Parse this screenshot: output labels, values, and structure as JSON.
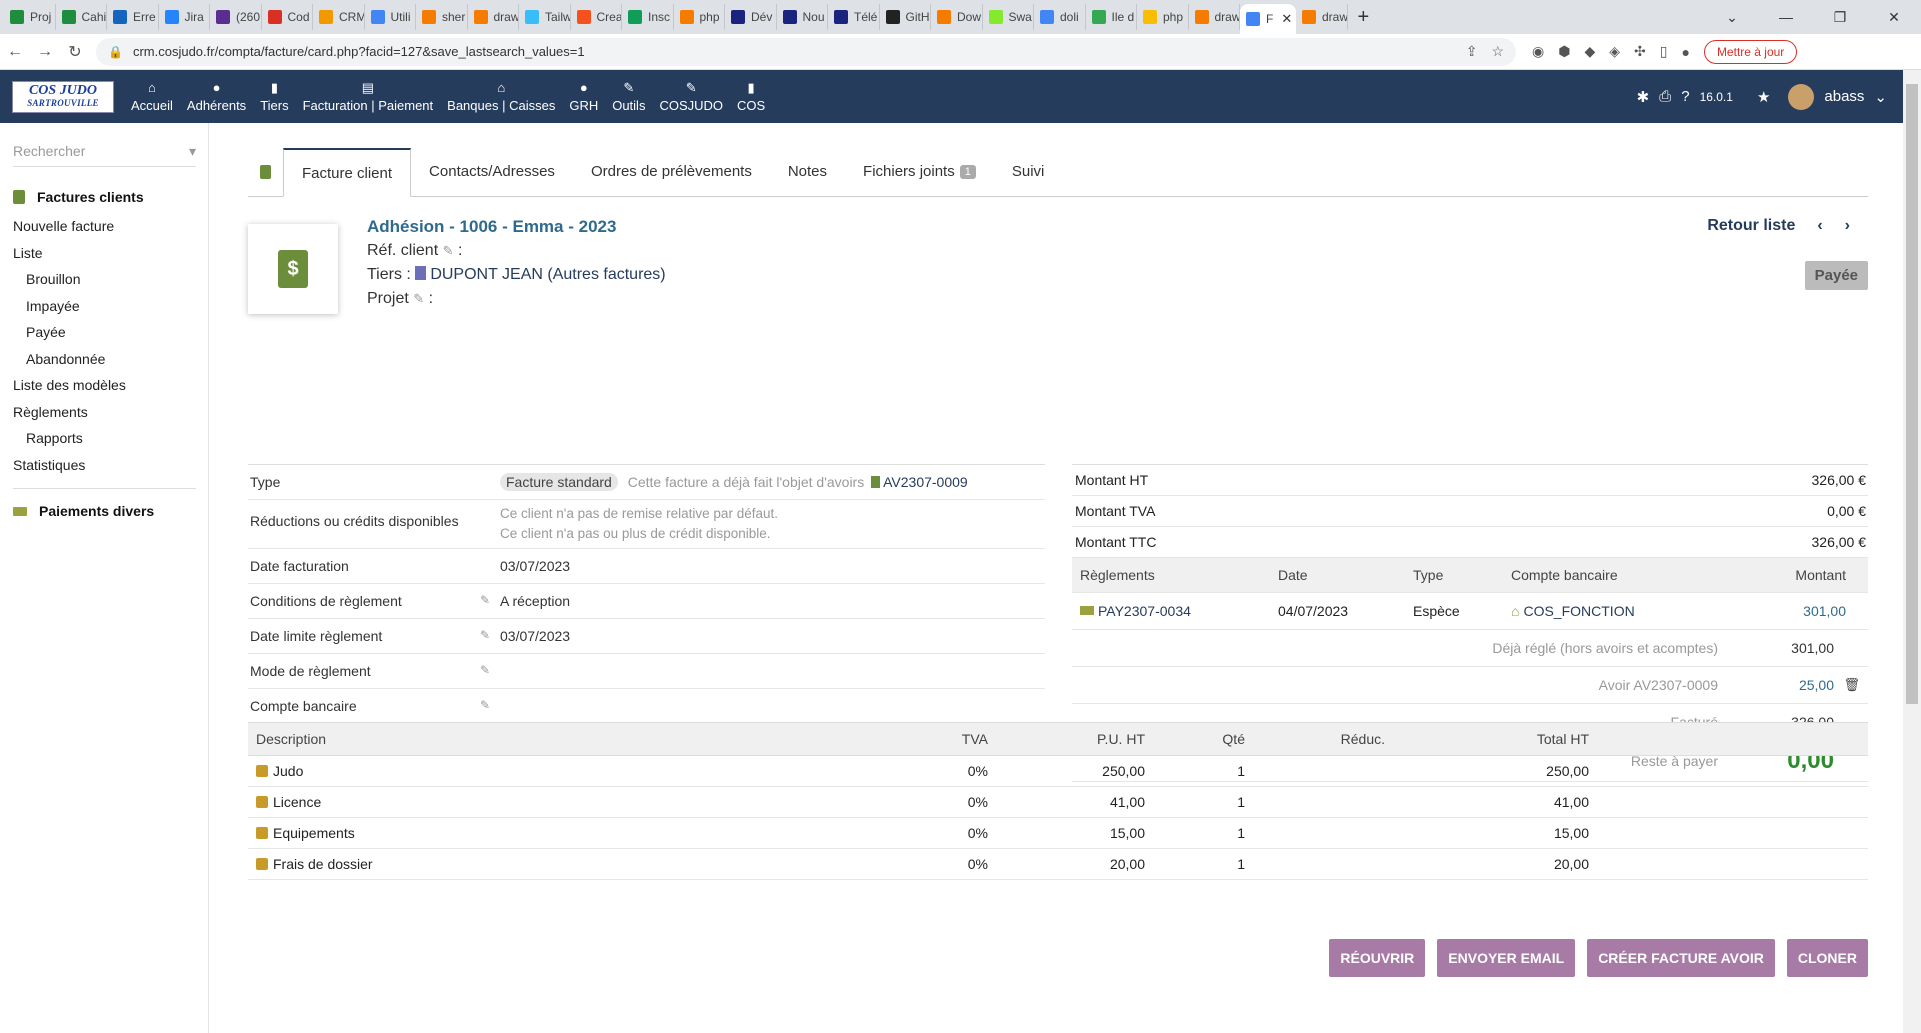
{
  "browser": {
    "tabs": [
      {
        "label": "Proj",
        "color": "#1e8e3e"
      },
      {
        "label": "Cahi",
        "color": "#1e8e3e"
      },
      {
        "label": "Erre",
        "color": "#1565c0"
      },
      {
        "label": "Jira",
        "color": "#2684ff"
      },
      {
        "label": "(260",
        "color": "#5c2d91"
      },
      {
        "label": "Cod",
        "color": "#d93025"
      },
      {
        "label": "CRM",
        "color": "#f29900"
      },
      {
        "label": "Utili",
        "color": "#4285f4"
      },
      {
        "label": "sher",
        "color": "#f57c00"
      },
      {
        "label": "draw",
        "color": "#f57c00"
      },
      {
        "label": "Tailw",
        "color": "#38bdf8"
      },
      {
        "label": "Crea",
        "color": "#f4511e"
      },
      {
        "label": "Insc",
        "color": "#0f9d58"
      },
      {
        "label": "php",
        "color": "#f57c00"
      },
      {
        "label": "Dév",
        "color": "#1a237e"
      },
      {
        "label": "Nou",
        "color": "#1a237e"
      },
      {
        "label": "Télé",
        "color": "#1a237e"
      },
      {
        "label": "GitH",
        "color": "#222222"
      },
      {
        "label": "Dow",
        "color": "#f57c00"
      },
      {
        "label": "Swa",
        "color": "#85ea2d"
      },
      {
        "label": "doli",
        "color": "#4285f4"
      },
      {
        "label": "Ile d",
        "color": "#34a853"
      },
      {
        "label": "php",
        "color": "#fbbc04"
      },
      {
        "label": "draw",
        "color": "#f57c00"
      },
      {
        "label": "F",
        "color": "#4285f4",
        "active": true
      },
      {
        "label": "draw",
        "color": "#f57c00"
      }
    ],
    "new_tab": "+",
    "window_controls": [
      "⌄",
      "—",
      "❐",
      "✕"
    ],
    "url": "crm.cosjudo.fr/compta/facture/card.php?facid=127&save_lastsearch_values=1",
    "update_button": "Mettre à jour"
  },
  "app": {
    "logo_line1": "COS JUDO",
    "logo_line2": "SARTROUVILLE",
    "menu": [
      {
        "label": "Accueil",
        "icon": "home-icon",
        "glyph": "⌂"
      },
      {
        "label": "Adhérents",
        "icon": "user-icon",
        "glyph": "●"
      },
      {
        "label": "Tiers",
        "icon": "building-icon",
        "glyph": "▮"
      },
      {
        "label": "Facturation | Paiement",
        "icon": "invoice-icon",
        "glyph": "▤"
      },
      {
        "label": "Banques | Caisses",
        "icon": "bank-icon",
        "glyph": "⌂"
      },
      {
        "label": "GRH",
        "icon": "users-icon",
        "glyph": "●"
      },
      {
        "label": "Outils",
        "icon": "wrench-icon",
        "glyph": "✎"
      },
      {
        "label": "COSJUDO",
        "icon": "edit-icon",
        "glyph": "✎"
      },
      {
        "label": "COS",
        "icon": "note-icon",
        "glyph": "▮"
      }
    ],
    "version": "16.0.1",
    "user": "abass"
  },
  "sidebar": {
    "search_placeholder": "Rechercher",
    "section1": "Factures clients",
    "items": [
      {
        "label": "Nouvelle facture",
        "sub": false
      },
      {
        "label": "Liste",
        "sub": false
      },
      {
        "label": "Brouillon",
        "sub": true
      },
      {
        "label": "Impayée",
        "sub": true
      },
      {
        "label": "Payée",
        "sub": true
      },
      {
        "label": "Abandonnée",
        "sub": true
      },
      {
        "label": "Liste des modèles",
        "sub": false
      },
      {
        "label": "Règlements",
        "sub": false
      },
      {
        "label": "Rapports",
        "sub": true
      },
      {
        "label": "Statistiques",
        "sub": false
      }
    ],
    "section2": "Paiements divers"
  },
  "tabs": [
    {
      "label": "Facture client",
      "active": true
    },
    {
      "label": "Contacts/Adresses"
    },
    {
      "label": "Ordres de prélèvements"
    },
    {
      "label": "Notes"
    },
    {
      "label": "Fichiers joints",
      "badge": "1"
    },
    {
      "label": "Suivi"
    }
  ],
  "invoice": {
    "title": "Adhésion - 1006 - Emma - 2023",
    "ref_client_label": "Réf. client",
    "tiers_label": "Tiers :",
    "tiers_value": "DUPONT JEAN (Autres factures)",
    "projet_label": "Projet",
    "back_to_list": "Retour liste",
    "status": "Payée"
  },
  "fields": {
    "type_label": "Type",
    "type_tag": "Facture standard",
    "type_note": "Cette facture a déjà fait l'objet d'avoirs",
    "type_credit_ref": "AV2307-0009",
    "discounts_label": "Réductions ou crédits disponibles",
    "discounts_line1": "Ce client n'a pas de remise relative par défaut.",
    "discounts_line2": "Ce client n'a pas ou plus de crédit disponible.",
    "date_label": "Date facturation",
    "date_value": "03/07/2023",
    "conditions_label": "Conditions de règlement",
    "conditions_value": "A réception",
    "due_label": "Date limite règlement",
    "due_value": "03/07/2023",
    "mode_label": "Mode de règlement",
    "mode_value": "",
    "bank_label": "Compte bancaire",
    "bank_value": ""
  },
  "amounts": {
    "ht_label": "Montant HT",
    "ht_value": "326,00 €",
    "tva_label": "Montant TVA",
    "tva_value": "0,00 €",
    "ttc_label": "Montant TTC",
    "ttc_value": "326,00 €"
  },
  "payments": {
    "headers": [
      "Règlements",
      "Date",
      "Type",
      "Compte bancaire",
      "Montant"
    ],
    "rows": [
      {
        "ref": "PAY2307-0034",
        "date": "04/07/2023",
        "type": "Espèce",
        "account": "COS_FONCTION",
        "amount": "301,00"
      }
    ],
    "already_paid_label": "Déjà réglé (hors avoirs et acomptes)",
    "already_paid_value": "301,00",
    "credit_label": "Avoir AV2307-0009",
    "credit_value": "25,00",
    "billed_label": "Facturé",
    "billed_value": "326,00",
    "remaining_label": "Reste à payer",
    "remaining_value": "0,00"
  },
  "lines": {
    "headers": [
      "Description",
      "TVA",
      "P.U. HT",
      "Qté",
      "Réduc.",
      "Total HT"
    ],
    "rows": [
      {
        "desc": "Judo",
        "tva": "0%",
        "pu": "250,00",
        "qty": "1",
        "reduc": "",
        "total": "250,00"
      },
      {
        "desc": "Licence",
        "tva": "0%",
        "pu": "41,00",
        "qty": "1",
        "reduc": "",
        "total": "41,00"
      },
      {
        "desc": "Equipements",
        "tva": "0%",
        "pu": "15,00",
        "qty": "1",
        "reduc": "",
        "total": "15,00"
      },
      {
        "desc": "Frais de dossier",
        "tva": "0%",
        "pu": "20,00",
        "qty": "1",
        "reduc": "",
        "total": "20,00"
      }
    ]
  },
  "actions": [
    "RÉOUVRIR",
    "ENVOYER EMAIL",
    "CRÉER FACTURE AVOIR",
    "CLONER"
  ]
}
